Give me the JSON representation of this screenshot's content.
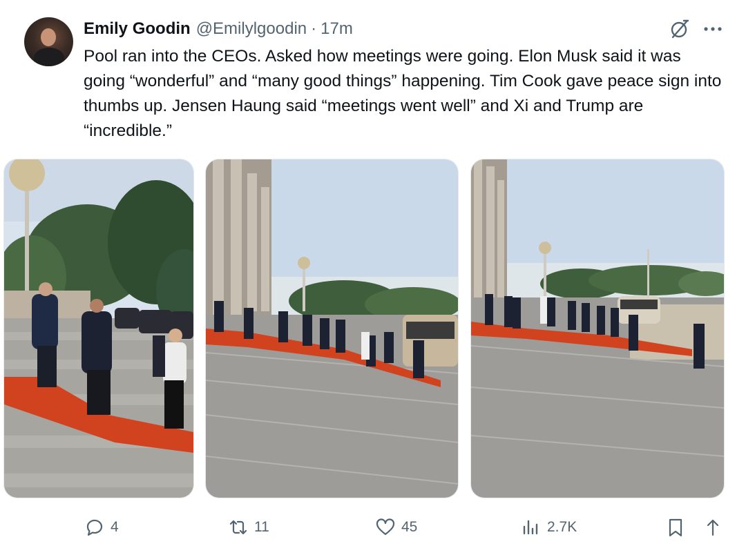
{
  "tweet": {
    "author": {
      "name": "Emily Goodin",
      "handle": "@Emilylgoodin",
      "separator": "·",
      "time": "17m"
    },
    "text": "Pool ran into the CEOs. Asked how meetings were going. Elon Musk said it was going “wonderful” and “many good things” happening. Tim Cook gave peace sign into thumbs up. Jensen Haung said “meetings went well” and Xi and Trump are “incredible.”",
    "icons": {
      "grok": "grok-icon",
      "more": "more-icon"
    },
    "photos": [
      {
        "name": "photo-steps-closeup"
      },
      {
        "name": "photo-hall-columns"
      },
      {
        "name": "photo-steps-wide"
      }
    ],
    "actions": {
      "reply_count": "4",
      "retweet_count": "11",
      "like_count": "45",
      "views_count": "2.7K"
    },
    "colors": {
      "text": "#0f1419",
      "muted": "#536471",
      "carpet": "#d1421f"
    }
  }
}
